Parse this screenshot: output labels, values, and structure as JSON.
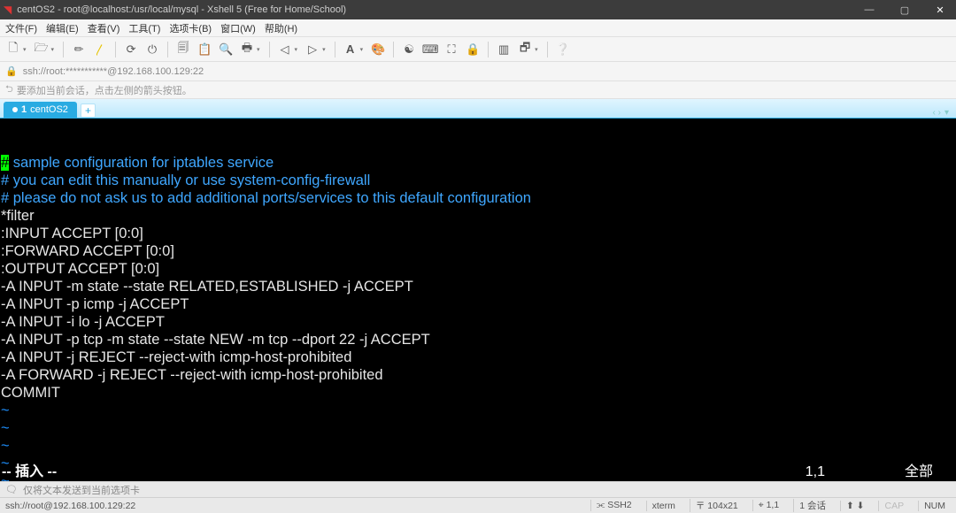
{
  "titlebar": {
    "title": "centOS2 - root@localhost:/usr/local/mysql - Xshell 5 (Free for Home/School)",
    "min": "—",
    "max": "▢",
    "close": "✕"
  },
  "menubar": {
    "items": [
      "文件(F)",
      "编辑(E)",
      "查看(V)",
      "工具(T)",
      "选项卡(B)",
      "窗口(W)",
      "帮助(H)"
    ]
  },
  "toolbar": {
    "icons": [
      "new-session-icon",
      "open-icon",
      "properties-icon",
      "scissors-icon",
      "highlighter-icon",
      "sep",
      "reconnect-icon",
      "disconnect-icon",
      "sep",
      "copy-icon",
      "paste-icon",
      "find-icon",
      "print-icon",
      "sep",
      "history-left-icon",
      "history-right-icon",
      "sep",
      "font-icon",
      "color-icon",
      "sep",
      "sync-icon",
      "fullscreen-icon",
      "transparency-icon",
      "lock-icon",
      "sep",
      "tile-icon",
      "cascade-icon",
      "sep",
      "help-icon"
    ]
  },
  "addrbar": {
    "text": "ssh://root:***********@192.168.100.129:22"
  },
  "hintbar": {
    "text": "要添加当前会话，点击左侧的箭头按钮。"
  },
  "tabbar": {
    "tab1_num": "1",
    "tab1_label": "centOS2",
    "add": "+",
    "right_left": "‹ ›",
    "right_menu": "▾"
  },
  "terminal": {
    "lines": [
      {
        "type": "hashcomment",
        "hash": "#",
        "rest": " sample configuration for iptables service"
      },
      {
        "type": "comment",
        "text": "# you can edit this manually or use system-config-firewall"
      },
      {
        "type": "comment",
        "text": "# please do not ask us to add additional ports/services to this default configuration"
      },
      {
        "type": "plain",
        "text": "*filter"
      },
      {
        "type": "plain",
        "text": ":INPUT ACCEPT [0:0]"
      },
      {
        "type": "plain",
        "text": ":FORWARD ACCEPT [0:0]"
      },
      {
        "type": "plain",
        "text": ":OUTPUT ACCEPT [0:0]"
      },
      {
        "type": "plain",
        "text": "-A INPUT -m state --state RELATED,ESTABLISHED -j ACCEPT"
      },
      {
        "type": "plain",
        "text": "-A INPUT -p icmp -j ACCEPT"
      },
      {
        "type": "plain",
        "text": "-A INPUT -i lo -j ACCEPT"
      },
      {
        "type": "plain",
        "text": "-A INPUT -p tcp -m state --state NEW -m tcp --dport 22 -j ACCEPT"
      },
      {
        "type": "plain",
        "text": "-A INPUT -j REJECT --reject-with icmp-host-prohibited"
      },
      {
        "type": "plain",
        "text": "-A FORWARD -j REJECT --reject-with icmp-host-prohibited"
      },
      {
        "type": "plain",
        "text": "COMMIT"
      },
      {
        "type": "tilde",
        "text": "~"
      },
      {
        "type": "tilde",
        "text": "~"
      },
      {
        "type": "tilde",
        "text": "~"
      },
      {
        "type": "tilde",
        "text": "~"
      },
      {
        "type": "tilde",
        "text": "~"
      },
      {
        "type": "blank",
        "text": ""
      }
    ],
    "vim_mode": "-- 插入 --",
    "vim_pos": "1,1",
    "vim_all": "全部"
  },
  "msgbar": {
    "text": "仅将文本发送到当前选项卡"
  },
  "statusbar": {
    "left": "ssh://root@192.168.100.129:22",
    "seg1": "⫘ SSH2",
    "seg2": "xterm",
    "seg3": "〒 104x21",
    "seg4": "⌖ 1,1",
    "seg5": "1 会话",
    "seg6": "⬆ ⬇",
    "cap": "CAP",
    "num": "NUM"
  }
}
